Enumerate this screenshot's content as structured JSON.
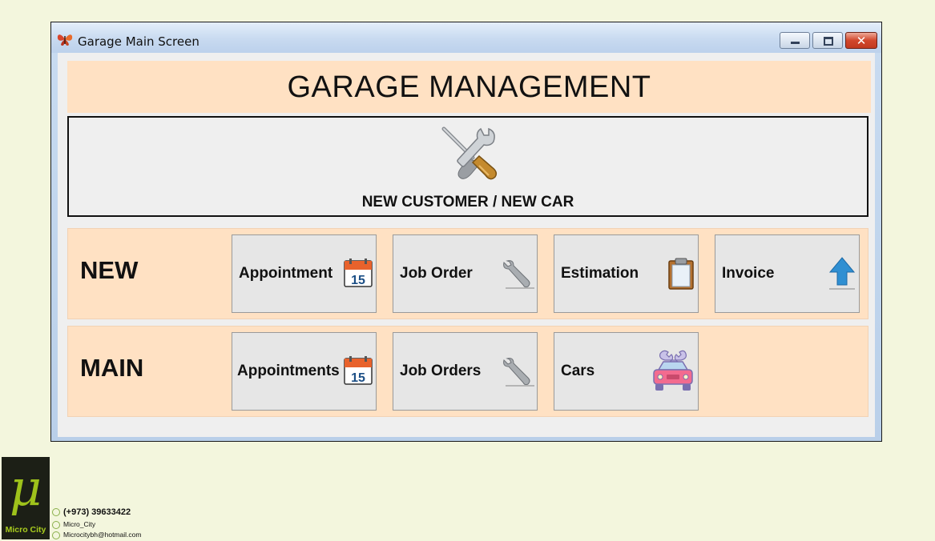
{
  "window": {
    "title": "Garage Main Screen",
    "close_glyph": "✕"
  },
  "header": {
    "title": "GARAGE MANAGEMENT"
  },
  "new_customer": {
    "label": "NEW CUSTOMER / NEW CAR",
    "icon": "tools-icon"
  },
  "new_row": {
    "label": "NEW",
    "tiles": [
      {
        "label": "Appointment",
        "icon": "calendar-icon",
        "calendar_day": "15"
      },
      {
        "label": "Job Order",
        "icon": "wrench-icon"
      },
      {
        "label": "Estimation",
        "icon": "clipboard-icon"
      },
      {
        "label": "Invoice",
        "icon": "up-arrow-icon"
      }
    ]
  },
  "main_row": {
    "label": "MAIN",
    "tiles": [
      {
        "label": "Appointments",
        "icon": "calendar-icon",
        "calendar_day": "15"
      },
      {
        "label": "Job Orders",
        "icon": "wrench-icon"
      },
      {
        "label": "Cars",
        "icon": "car-service-icon"
      }
    ]
  },
  "branding": {
    "logo_glyph": "μ",
    "name": "Micro City",
    "phone": "(+973) 39633422",
    "handle": "Micro_City",
    "email": "Microcitybh@hotmail.com"
  },
  "colors": {
    "background": "#f3f6dd",
    "panel_peach": "#ffe1c3",
    "tile_gray": "#e6e6e6",
    "calendar_orange": "#e8622c",
    "calendar_blue": "#1c4f86",
    "arrow_blue": "#2f8fd2",
    "car_pink": "#f36b8f",
    "logo_green": "#9ec21b"
  }
}
